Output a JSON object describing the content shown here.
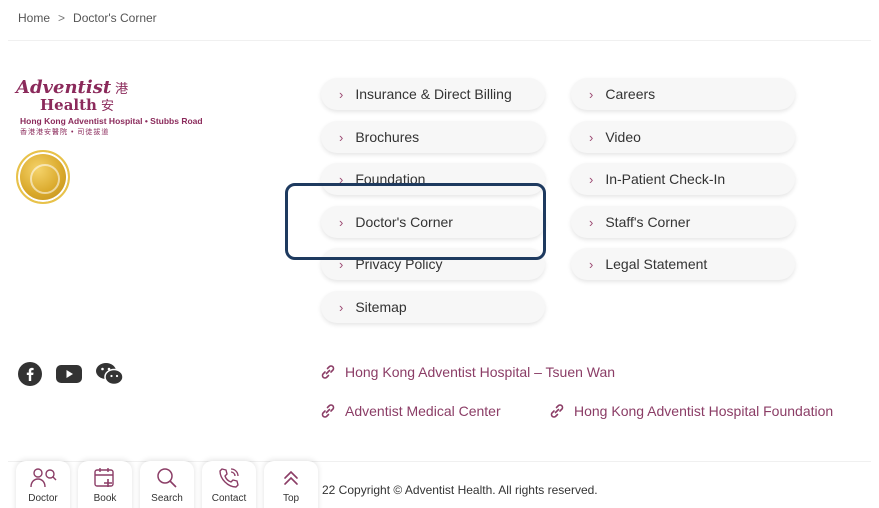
{
  "breadcrumb": {
    "home": "Home",
    "separator": ">",
    "current": "Doctor's Corner"
  },
  "logo": {
    "word1": "Adventist",
    "cjk1": "港",
    "word2": "Health",
    "cjk2": "安",
    "hospital": "Hong Kong Adventist Hospital • Stubbs Road",
    "hospital_cjk": "香港港安醫院 • 司徒拔道"
  },
  "menu": {
    "col1": [
      "Insurance & Direct Billing",
      "Brochures",
      "Foundation",
      "Doctor's Corner",
      "Privacy Policy",
      "Sitemap"
    ],
    "col2": [
      "Careers",
      "Video",
      "In-Patient Check-In",
      "Staff's Corner",
      "Legal Statement"
    ],
    "chevron": "›"
  },
  "links": {
    "tsuen_wan": "Hong Kong Adventist Hospital – Tsuen Wan",
    "amc": "Adventist Medical Center",
    "foundation": "Hong Kong Adventist Hospital Foundation"
  },
  "copyright": "22 Copyright © Adventist Health. All rights reserved.",
  "tabbar": {
    "doctor": "Doctor",
    "book": "Book",
    "search": "Search",
    "contact": "Contact",
    "top": "Top"
  },
  "colors": {
    "brand": "#8b2a5b",
    "link": "#8b3d66",
    "highlight": "#1e3a5f"
  }
}
